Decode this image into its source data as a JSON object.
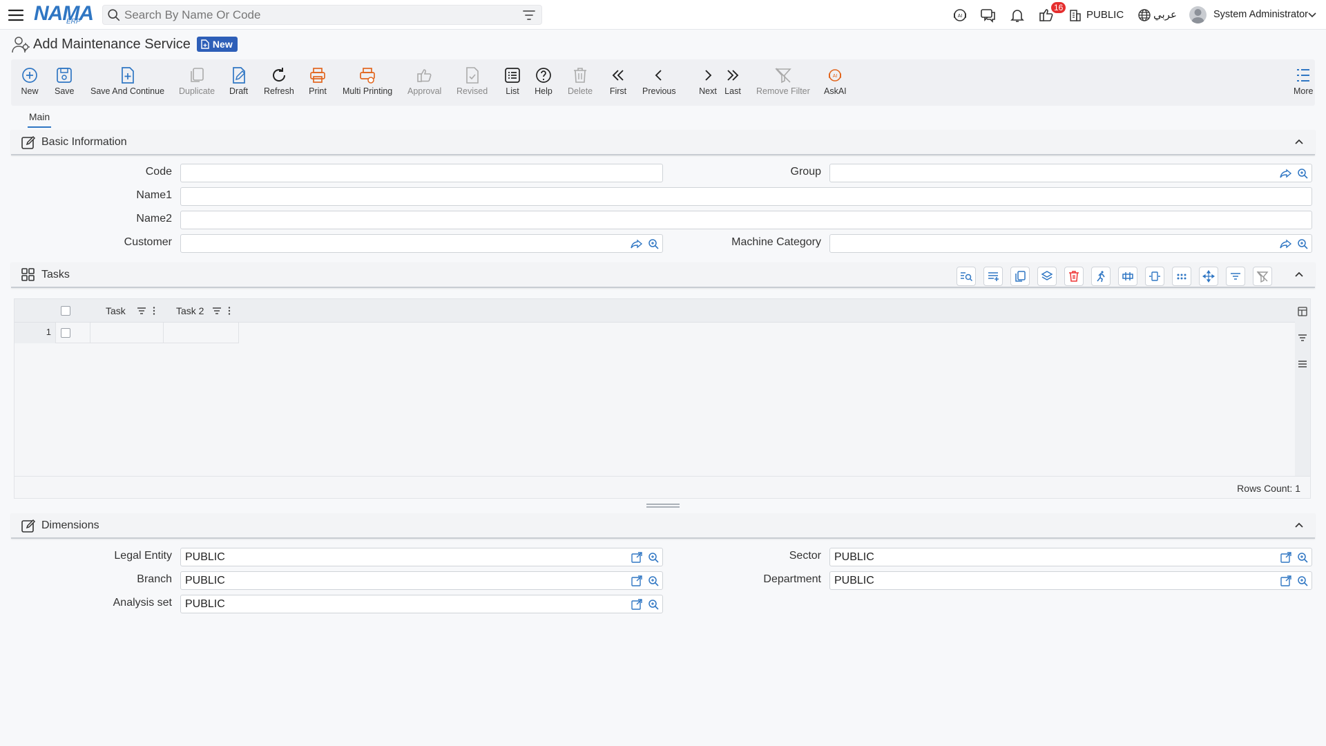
{
  "header": {
    "logo_text": "NAMA",
    "logo_sub": "ERP",
    "search_placeholder": "Search By Name Or Code",
    "notification_count": "16",
    "entity": "PUBLIC",
    "language": "عربي",
    "user": "System Administrator"
  },
  "page": {
    "title": "Add Maintenance Service",
    "status_badge": "New"
  },
  "toolbar": {
    "new": "New",
    "save": "Save",
    "save_continue": "Save And Continue",
    "duplicate": "Duplicate",
    "draft": "Draft",
    "refresh": "Refresh",
    "print": "Print",
    "multi_printing": "Multi Printing",
    "approval": "Approval",
    "revised": "Revised",
    "list": "List",
    "help": "Help",
    "delete": "Delete",
    "first": "First",
    "previous": "Previous",
    "next": "Next",
    "last": "Last",
    "remove_filter": "Remove Filter",
    "askai": "AskAI",
    "more": "More"
  },
  "tabs": {
    "main": "Main"
  },
  "basic_info": {
    "title": "Basic Information",
    "code_label": "Code",
    "code_value": "",
    "group_label": "Group",
    "group_value": "",
    "name1_label": "Name1",
    "name1_value": "",
    "name2_label": "Name2",
    "name2_value": "",
    "customer_label": "Customer",
    "customer_value": "",
    "machine_category_label": "Machine Category",
    "machine_category_value": ""
  },
  "tasks": {
    "title": "Tasks",
    "columns": [
      "Task",
      "Task 2"
    ],
    "rows": [
      {
        "num": "1",
        "task": "",
        "task2": ""
      }
    ],
    "rows_count": "Rows Count: 1"
  },
  "dimensions": {
    "title": "Dimensions",
    "legal_entity_label": "Legal Entity",
    "legal_entity_value": "PUBLIC",
    "sector_label": "Sector",
    "sector_value": "PUBLIC",
    "branch_label": "Branch",
    "branch_value": "PUBLIC",
    "department_label": "Department",
    "department_value": "PUBLIC",
    "analysis_set_label": "Analysis set",
    "analysis_set_value": "PUBLIC"
  },
  "colors": {
    "accent": "#2f76c3",
    "print_orange": "#e2661e",
    "badge_red": "#e52e2e",
    "new_badge": "#2e5fb8"
  }
}
